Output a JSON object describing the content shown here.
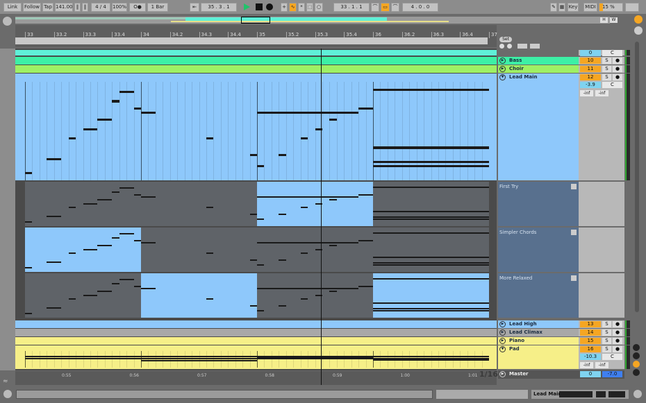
{
  "toolbar": {
    "link": "Link",
    "follow": "Follow",
    "tap": "Tap",
    "tempo": "141.00",
    "signature": "4 / 4",
    "zoom": "100%",
    "metronome": "O●",
    "quantize": "1 Bar",
    "position": "35 .  3 .  1",
    "loop_start": "33 .  1 .  1",
    "loop_length": "4 .  0 .  0",
    "key": "Key",
    "midi": "MIDI",
    "cpu": "15 %"
  },
  "overview": {
    "h": "H",
    "w": "W"
  },
  "ruler": {
    "ticks": [
      "33",
      "33.2",
      "33.3",
      "33.4",
      "34",
      "34.2",
      "34.3",
      "34.4",
      "35",
      "35.2",
      "35.3",
      "35.4",
      "36",
      "36.2",
      "36.3",
      "36.4",
      "37"
    ],
    "set": "Set"
  },
  "time_ruler": {
    "ticks": [
      "0:55",
      "0:56",
      "0:57",
      "0:58",
      "0:59",
      "1:00",
      "1:01"
    ],
    "grid": "1/16"
  },
  "colors": {
    "cyan": "#5ff0d8",
    "bass": "#3df0a6",
    "choir": "#9ef064",
    "lead": "#8ec8fb",
    "gray": "#a8a8a8",
    "yellow": "#f6ef88",
    "take_inactive": "#5f6368",
    "accent": "#f5a623"
  },
  "tracks": [
    {
      "name": "",
      "number": "",
      "volume": "0",
      "pan": "C"
    },
    {
      "name": "Bass",
      "number": "10",
      "solo": "S"
    },
    {
      "name": "Choir",
      "number": "11",
      "solo": "S"
    },
    {
      "name": "Lead Main",
      "number": "12",
      "solo": "S",
      "volume": "-3.9",
      "pan": "C",
      "peak_l": "-inf",
      "peak_r": "-inf"
    },
    {
      "name": "Lead High",
      "number": "13",
      "solo": "S"
    },
    {
      "name": "Lead Climax",
      "number": "14",
      "solo": "S"
    },
    {
      "name": "Piano",
      "number": "15",
      "solo": "S"
    },
    {
      "name": "Pad",
      "number": "16",
      "solo": "S",
      "volume": "-10.3",
      "pan": "C",
      "peak_l": "-inf",
      "peak_r": "-inf"
    },
    {
      "name": "Master",
      "volume": "0",
      "pan": "-7.0"
    }
  ],
  "take_lanes": [
    {
      "name": "First Try",
      "active_bars": [
        2
      ]
    },
    {
      "name": "Simpler Chords",
      "active_bars": [
        0
      ]
    },
    {
      "name": "More Relaxed",
      "active_bars": [
        1,
        3
      ]
    }
  ],
  "lead_main_notes": [
    [
      0,
      0.25,
      60
    ],
    [
      0.75,
      0.5,
      66
    ],
    [
      1.5,
      0.25,
      75
    ],
    [
      2,
      0.5,
      79
    ],
    [
      2.5,
      0.5,
      83
    ],
    [
      3,
      0.25,
      91
    ],
    [
      3.25,
      0.5,
      95
    ],
    [
      3.75,
      0.25,
      88
    ],
    [
      4,
      0.5,
      86
    ],
    [
      6.25,
      0.25,
      75
    ],
    [
      7.75,
      0.25,
      68
    ],
    [
      8,
      0.25,
      63
    ],
    [
      8,
      3.5,
      86
    ],
    [
      8.75,
      0.25,
      68
    ],
    [
      9.5,
      0.25,
      75
    ],
    [
      10,
      0.25,
      79
    ],
    [
      10.5,
      0.25,
      83
    ],
    [
      11.5,
      0.5,
      88
    ],
    [
      12,
      4,
      96
    ],
    [
      12,
      4,
      71
    ],
    [
      12,
      4,
      65
    ],
    [
      12,
      4,
      63
    ]
  ],
  "status": {
    "selected_track": "Lead Main"
  }
}
